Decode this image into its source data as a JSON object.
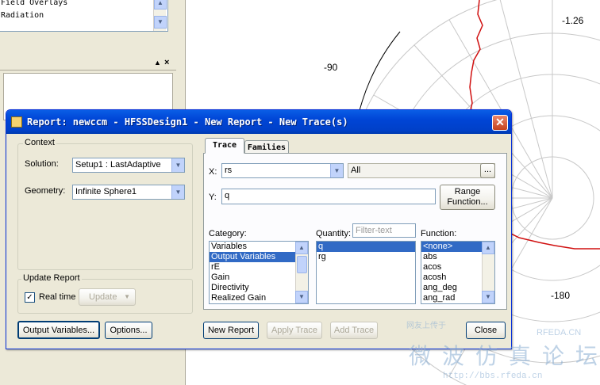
{
  "tree": {
    "items": [
      "Field Overlays",
      "Radiation"
    ]
  },
  "plot": {
    "labels": [
      "-90",
      "-1.26",
      "-180"
    ]
  },
  "dialog": {
    "title": "Report: newccm - HFSSDesign1 - New Report - New Trace(s)",
    "close_glyph": "✕",
    "context": {
      "legend": "Context",
      "solution_label": "Solution:",
      "solution_value": "Setup1 : LastAdaptive",
      "geometry_label": "Geometry:",
      "geometry_value": "Infinite Sphere1"
    },
    "update_report": {
      "legend": "Update Report",
      "realtime_label": "Real time",
      "realtime_checked": true,
      "update_label": "Update"
    },
    "tabs": [
      "Trace",
      "Families"
    ],
    "x_label": "X:",
    "x_value": "rs",
    "x_range_value": "All",
    "ellipsis": "...",
    "y_label": "Y:",
    "y_value": "q",
    "range_button": {
      "line1": "Range",
      "line2": "Function..."
    },
    "category": {
      "label": "Category:",
      "items": [
        "Variables",
        "Output Variables",
        "rE",
        "Gain",
        "Directivity",
        "Realized Gain"
      ],
      "selected": "Output Variables"
    },
    "quantity": {
      "label": "Quantity:",
      "filter_placeholder": "Filter-text",
      "items": [
        "q",
        "rg"
      ],
      "selected": "q"
    },
    "function": {
      "label": "Function:",
      "items": [
        "<none>",
        "abs",
        "acos",
        "acosh",
        "ang_deg",
        "ang_rad"
      ],
      "selected": "<none>"
    },
    "buttons": {
      "output_variables": "Output Variables...",
      "options": "Options...",
      "new_report": "New Report",
      "apply_trace": "Apply Trace",
      "add_trace": "Add Trace",
      "close": "Close"
    }
  },
  "watermark": {
    "line1": "RFEDA.CN",
    "line2": "微波仿真论坛",
    "line3": "http://bbs.rfeda.cn",
    "line4": "网友上传于"
  }
}
